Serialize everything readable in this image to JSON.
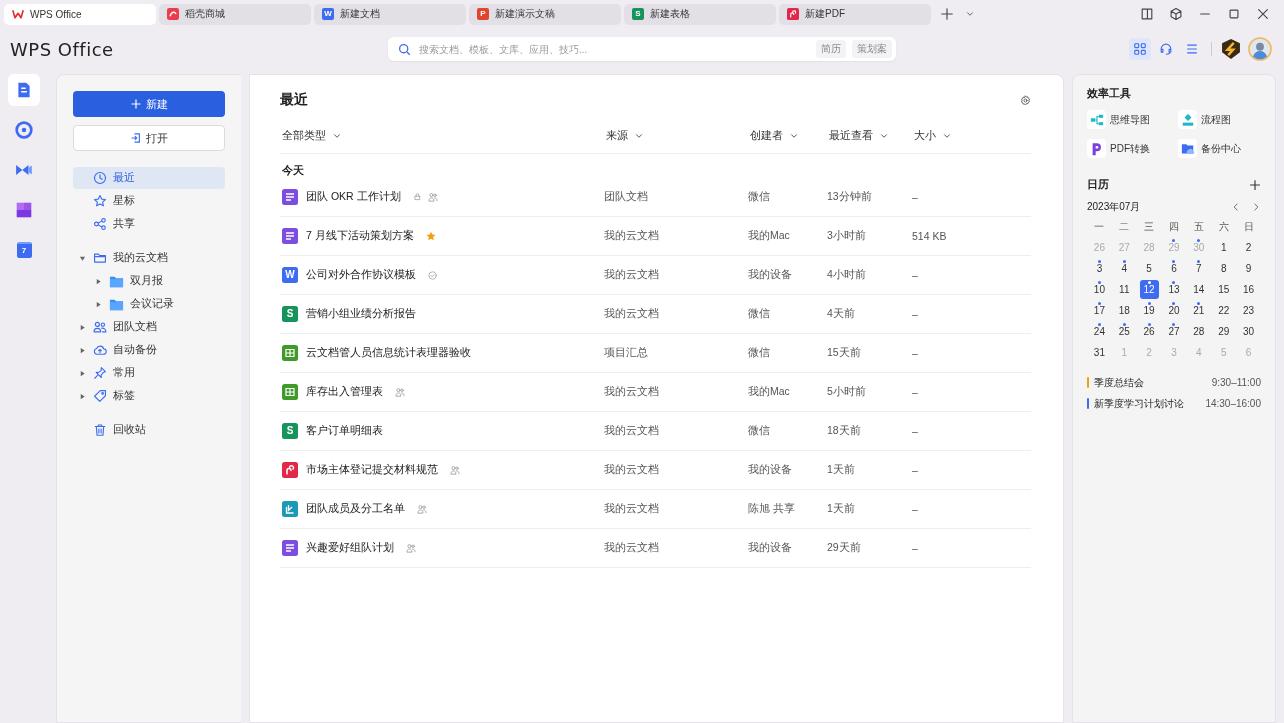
{
  "tabs": [
    {
      "label": "WPS Office",
      "kind": "home",
      "selected": true
    },
    {
      "label": "稻壳商城",
      "kind": "store",
      "selected": false
    },
    {
      "label": "新建文档",
      "kind": "letter",
      "letter": "W",
      "color": "#3d6cf0",
      "selected": false
    },
    {
      "label": "新建演示文稿",
      "kind": "letter",
      "letter": "P",
      "color": "#e1462c",
      "selected": false
    },
    {
      "label": "新建表格",
      "kind": "letter",
      "letter": "S",
      "color": "#17935c",
      "selected": false
    },
    {
      "label": "新建PDF",
      "kind": "pdf",
      "selected": false
    }
  ],
  "header": {
    "logo": "WPS Office",
    "search": {
      "placeholder": "搜索文档、模板、文库、应用、技巧...",
      "chips": [
        "简历",
        "策划案"
      ]
    }
  },
  "rail": [
    {
      "kind": "docs",
      "selected": true
    },
    {
      "kind": "compass",
      "selected": false
    },
    {
      "kind": "meeting",
      "selected": false
    },
    {
      "kind": "apps",
      "selected": false
    },
    {
      "kind": "calendar",
      "label": "7",
      "selected": false
    }
  ],
  "nav": {
    "new_button": "新建",
    "open_button": "打开",
    "quick": [
      {
        "label": "最近",
        "kind": "clock",
        "selected": true
      },
      {
        "label": "星标",
        "kind": "star",
        "selected": false
      },
      {
        "label": "共享",
        "kind": "share",
        "selected": false
      }
    ],
    "tree": [
      {
        "label": "我的云文档",
        "kind": "folder-outline",
        "expanded": true,
        "children": [
          {
            "label": "双月报",
            "kind": "folder",
            "expanded": false
          },
          {
            "label": "会议记录",
            "kind": "folder",
            "expanded": false
          }
        ]
      },
      {
        "label": "团队文档",
        "kind": "team",
        "expanded": false
      },
      {
        "label": "自动备份",
        "kind": "cloud",
        "expanded": false
      },
      {
        "label": "常用",
        "kind": "pin",
        "expanded": false
      },
      {
        "label": "标签",
        "kind": "tag",
        "expanded": false
      }
    ],
    "trash": "回收站"
  },
  "main": {
    "title": "最近",
    "columns": [
      "全部类型",
      "来源",
      "创建者",
      "最近查看",
      "大小"
    ],
    "group": "今天",
    "rows": [
      {
        "name": "团队 OKR 工作计划",
        "icon": {
          "kind": "note",
          "color": "#7b4ee0"
        },
        "marks": [
          {
            "kind": "lock"
          },
          {
            "kind": "shared"
          }
        ],
        "source": "团队文档",
        "creator": "微信",
        "viewed": "13分钟前",
        "size": "–"
      },
      {
        "name": "7 月线下活动策划方案",
        "icon": {
          "kind": "note",
          "color": "#7b4ee0"
        },
        "marks": [
          {
            "kind": "star"
          }
        ],
        "source": "我的云文档",
        "creator": "我的Mac",
        "viewed": "3小时前",
        "size": "514 KB"
      },
      {
        "name": "公司对外合作协议模板",
        "icon": {
          "kind": "letter",
          "letter": "W",
          "color": "#3d6cf0"
        },
        "marks": [
          {
            "kind": "verified"
          }
        ],
        "source": "我的云文档",
        "creator": "我的设备",
        "viewed": "4小时前",
        "size": "–"
      },
      {
        "name": "营销小组业绩分析报告",
        "icon": {
          "kind": "letter",
          "letter": "S",
          "color": "#17935c"
        },
        "marks": [],
        "source": "我的云文档",
        "creator": "微信",
        "viewed": "4天前",
        "size": "–"
      },
      {
        "name": "云文档管人员信息统计表理器验收",
        "icon": {
          "kind": "grid",
          "color": "#3f9a2a"
        },
        "marks": [],
        "source": "项目汇总",
        "creator": "微信",
        "viewed": "15天前",
        "size": "–"
      },
      {
        "name": "库存出入管理表",
        "icon": {
          "kind": "grid",
          "color": "#3f9a2a"
        },
        "marks": [
          {
            "kind": "shared"
          }
        ],
        "source": "我的云文档",
        "creator": "我的Mac",
        "viewed": "5小时前",
        "size": "–"
      },
      {
        "name": "客户订单明细表",
        "icon": {
          "kind": "letter",
          "letter": "S",
          "color": "#17935c"
        },
        "marks": [],
        "source": "我的云文档",
        "creator": "微信",
        "viewed": "18天前",
        "size": "–"
      },
      {
        "name": "市场主体登记提交材料规范",
        "icon": {
          "kind": "pdf",
          "color": "#e0284a"
        },
        "marks": [
          {
            "kind": "shared"
          }
        ],
        "source": "我的云文档",
        "creator": "我的设备",
        "viewed": "1天前",
        "size": "–"
      },
      {
        "name": "团队成员及分工名单",
        "icon": {
          "kind": "form",
          "color": "#1a9bb5"
        },
        "marks": [
          {
            "kind": "shared"
          }
        ],
        "source": "我的云文档",
        "creator": "陈旭 共享",
        "viewed": "1天前",
        "size": "–"
      },
      {
        "name": "兴趣爱好组队计划",
        "icon": {
          "kind": "note",
          "color": "#7b4ee0"
        },
        "marks": [
          {
            "kind": "shared"
          }
        ],
        "source": "我的云文档",
        "creator": "我的设备",
        "viewed": "29天前",
        "size": "–"
      }
    ]
  },
  "tools": {
    "title": "效率工具",
    "items": [
      {
        "label": "思维导图",
        "kind": "mindmap"
      },
      {
        "label": "流程图",
        "kind": "flow"
      },
      {
        "label": "PDF转换",
        "kind": "pdfconv"
      },
      {
        "label": "备份中心",
        "kind": "backup"
      }
    ]
  },
  "calendar": {
    "title": "日历",
    "month": "2023年07月",
    "weekdays": [
      "一",
      "二",
      "三",
      "四",
      "五",
      "六",
      "日"
    ],
    "days": [
      {
        "label": "26",
        "muted": true,
        "event": false,
        "selected": false
      },
      {
        "label": "27",
        "muted": true,
        "event": false,
        "selected": false
      },
      {
        "label": "28",
        "muted": true,
        "event": false,
        "selected": false
      },
      {
        "label": "29",
        "muted": true,
        "event": true,
        "selected": false
      },
      {
        "label": "30",
        "muted": true,
        "event": true,
        "selected": false
      },
      {
        "label": "1",
        "muted": false,
        "event": false,
        "selected": false
      },
      {
        "label": "2",
        "muted": false,
        "event": false,
        "selected": false
      },
      {
        "label": "3",
        "muted": false,
        "event": true,
        "selected": false
      },
      {
        "label": "4",
        "muted": false,
        "event": true,
        "selected": false
      },
      {
        "label": "5",
        "muted": false,
        "event": false,
        "selected": false
      },
      {
        "label": "6",
        "muted": false,
        "event": true,
        "selected": false
      },
      {
        "label": "7",
        "muted": false,
        "event": true,
        "selected": false
      },
      {
        "label": "8",
        "muted": false,
        "event": false,
        "selected": false
      },
      {
        "label": "9",
        "muted": false,
        "event": false,
        "selected": false
      },
      {
        "label": "10",
        "muted": false,
        "event": true,
        "selected": false
      },
      {
        "label": "11",
        "muted": false,
        "event": false,
        "selected": false
      },
      {
        "label": "12",
        "muted": false,
        "event": true,
        "selected": true
      },
      {
        "label": "13",
        "muted": false,
        "event": true,
        "selected": false
      },
      {
        "label": "14",
        "muted": false,
        "event": false,
        "selected": false
      },
      {
        "label": "15",
        "muted": false,
        "event": false,
        "selected": false
      },
      {
        "label": "16",
        "muted": false,
        "event": false,
        "selected": false
      },
      {
        "label": "17",
        "muted": false,
        "event": true,
        "selected": false
      },
      {
        "label": "18",
        "muted": false,
        "event": false,
        "selected": false
      },
      {
        "label": "19",
        "muted": false,
        "event": true,
        "selected": false
      },
      {
        "label": "20",
        "muted": false,
        "event": true,
        "selected": false
      },
      {
        "label": "21",
        "muted": false,
        "event": true,
        "selected": false
      },
      {
        "label": "22",
        "muted": false,
        "event": false,
        "selected": false
      },
      {
        "label": "23",
        "muted": false,
        "event": false,
        "selected": false
      },
      {
        "label": "24",
        "muted": false,
        "event": true,
        "selected": false
      },
      {
        "label": "25",
        "muted": false,
        "event": true,
        "selected": false
      },
      {
        "label": "26",
        "muted": false,
        "event": true,
        "selected": false
      },
      {
        "label": "27",
        "muted": false,
        "event": true,
        "selected": false
      },
      {
        "label": "28",
        "muted": false,
        "event": false,
        "selected": false
      },
      {
        "label": "29",
        "muted": false,
        "event": false,
        "selected": false
      },
      {
        "label": "30",
        "muted": false,
        "event": false,
        "selected": false
      },
      {
        "label": "31",
        "muted": false,
        "event": false,
        "selected": false
      },
      {
        "label": "1",
        "muted": true,
        "event": false,
        "selected": false
      },
      {
        "label": "2",
        "muted": true,
        "event": false,
        "selected": false
      },
      {
        "label": "3",
        "muted": true,
        "event": false,
        "selected": false
      },
      {
        "label": "4",
        "muted": true,
        "event": false,
        "selected": false
      },
      {
        "label": "5",
        "muted": true,
        "event": false,
        "selected": false
      },
      {
        "label": "6",
        "muted": true,
        "event": false,
        "selected": false
      }
    ],
    "events": [
      {
        "title": "季度总结会",
        "time": "9:30–11:00",
        "color": "#f0a010"
      },
      {
        "title": "新季度学习计划讨论",
        "time": "14:30–16:00",
        "color": "#3d6cf0"
      }
    ]
  }
}
